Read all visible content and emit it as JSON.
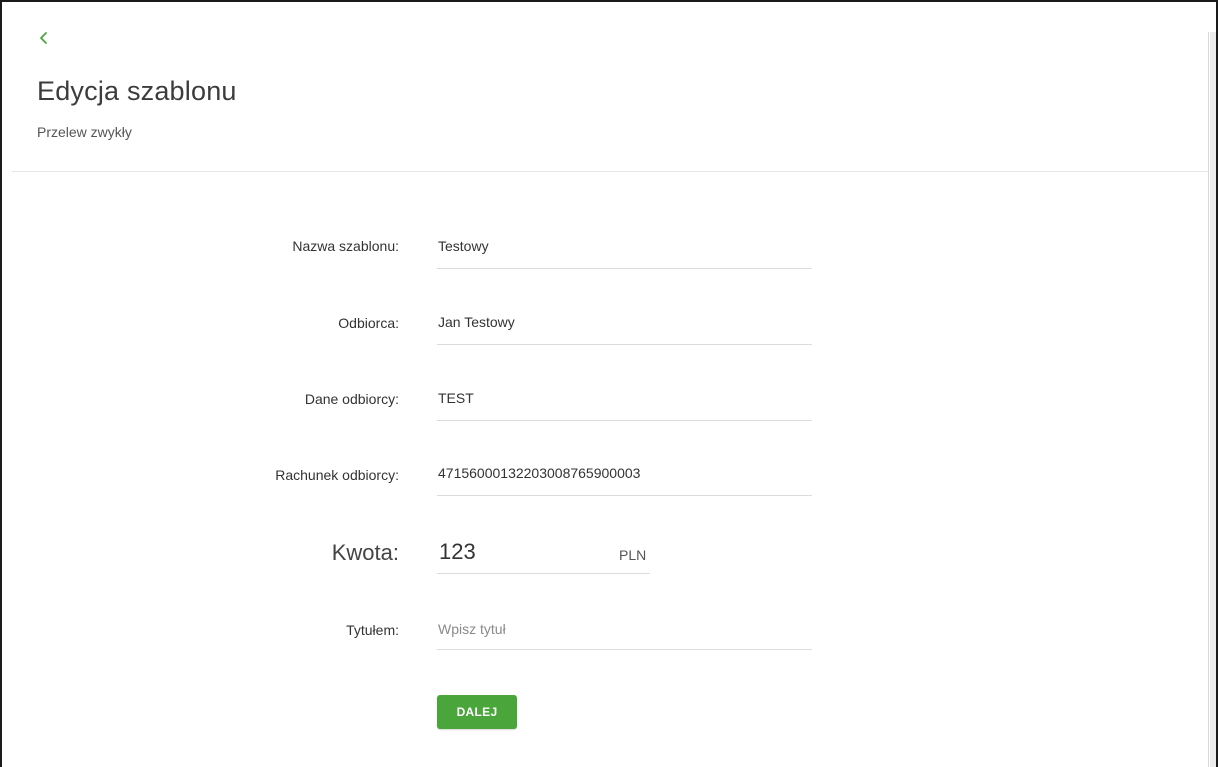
{
  "header": {
    "back_icon": "chevron-left-icon",
    "title": "Edycja szablonu",
    "subtitle": "Przelew zwykły"
  },
  "form": {
    "template_name": {
      "label": "Nazwa szablonu:",
      "value": "Testowy"
    },
    "recipient": {
      "label": "Odbiorca:",
      "value": "Jan Testowy"
    },
    "recipient_data": {
      "label": "Dane odbiorcy:",
      "value": "TEST"
    },
    "recipient_account": {
      "label": "Rachunek odbiorcy:",
      "value": "47156000132203008765900003"
    },
    "amount": {
      "label": "Kwota:",
      "value": "123",
      "currency": "PLN"
    },
    "transfer_title": {
      "label": "Tytułem:",
      "value": "",
      "placeholder": "Wpisz tytuł"
    },
    "next_button_label": "DALEJ"
  },
  "colors": {
    "accent": "#4aa53a",
    "text": "#333333",
    "divider": "#dcdcdc"
  }
}
